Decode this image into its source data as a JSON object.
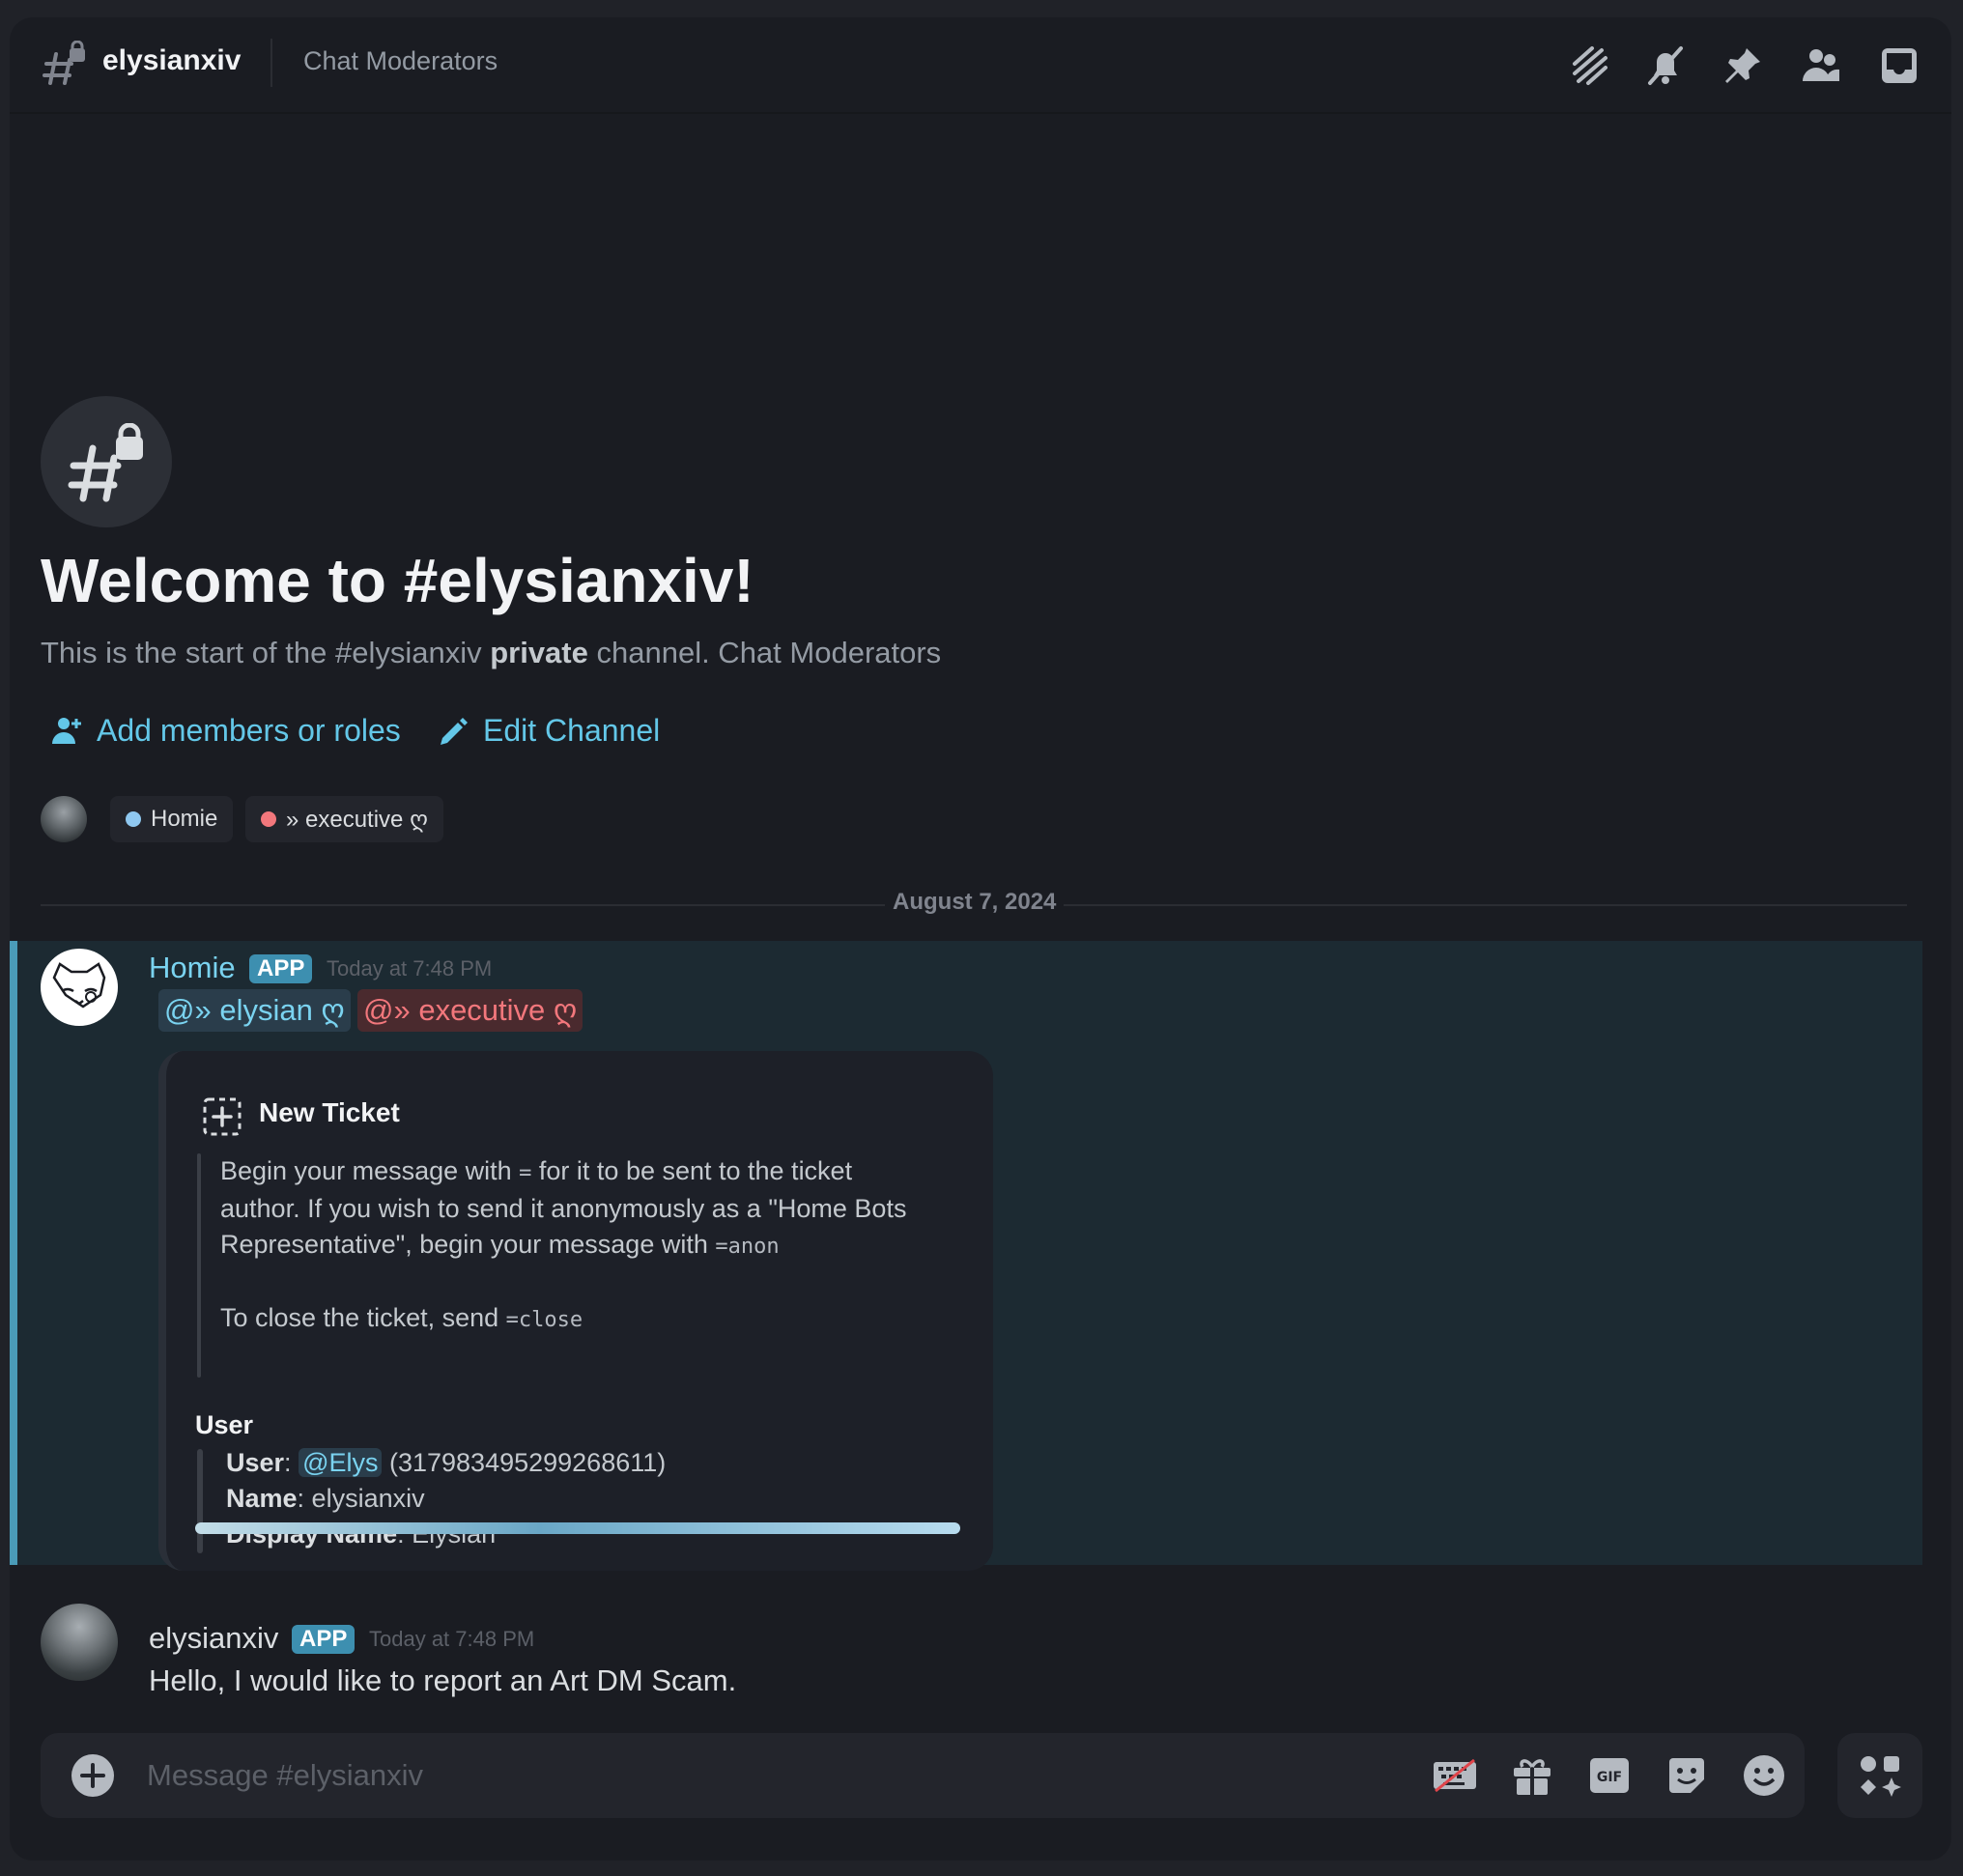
{
  "header": {
    "channel_name": "elysianxiv",
    "topic": "Chat Moderators",
    "icons": [
      "threads-icon",
      "notification-off-icon",
      "pin-icon",
      "member-list-icon",
      "inbox-icon"
    ]
  },
  "welcome": {
    "title": "Welcome to #elysianxiv!",
    "subtitle_start": "This is the start of the #elysianxiv ",
    "subtitle_bold": "private",
    "subtitle_end": " channel. Chat Moderators",
    "add_members_label": "Add members or roles",
    "edit_channel_label": "Edit Channel",
    "roles": [
      {
        "label": "Homie",
        "color": "#8fc8f0"
      },
      {
        "label": "» executive ღ",
        "color": "#f2777c"
      }
    ]
  },
  "date_divider": "August 7, 2024",
  "messages": [
    {
      "author": "Homie",
      "tag": "APP",
      "timestamp": "Today at 7:48 PM",
      "mentions": [
        "@» elysian ღ",
        "@» executive ღ"
      ],
      "embed": {
        "title": "New Ticket",
        "desc_line1_a": "Begin your message with ",
        "desc_code1": "=",
        "desc_line1_b": " for it to be sent to the ticket",
        "desc_line2": "author. If you wish to send it anonymously as a \"Home Bots",
        "desc_line3_a": "Representative\", begin your message with ",
        "desc_code2": "=anon",
        "desc_close_a": "To close the ticket, send ",
        "desc_code3": "=close",
        "field_name": "User",
        "user_label": "User",
        "user_mention": "@Elys",
        "user_id": " (317983495299268611)",
        "name_label": "Name",
        "name_value": ": elysianxiv",
        "display_label": "Display Name",
        "display_value": ": Elysian"
      }
    },
    {
      "author": "elysianxiv",
      "tag": "APP",
      "timestamp": "Today at 7:48 PM",
      "text": "Hello, I would like to report an Art DM Scam."
    }
  ],
  "composer": {
    "placeholder": "Message #elysianxiv",
    "icons": [
      "keyboard-off-icon",
      "gift-icon",
      "gif-icon",
      "sticker-icon",
      "emoji-icon"
    ]
  },
  "colors": {
    "accent_link": "#63c7e8",
    "highlight_bg": "#1c2a32",
    "highlight_border": "#4a9bb8",
    "app_tag": "#3d8fb0"
  }
}
